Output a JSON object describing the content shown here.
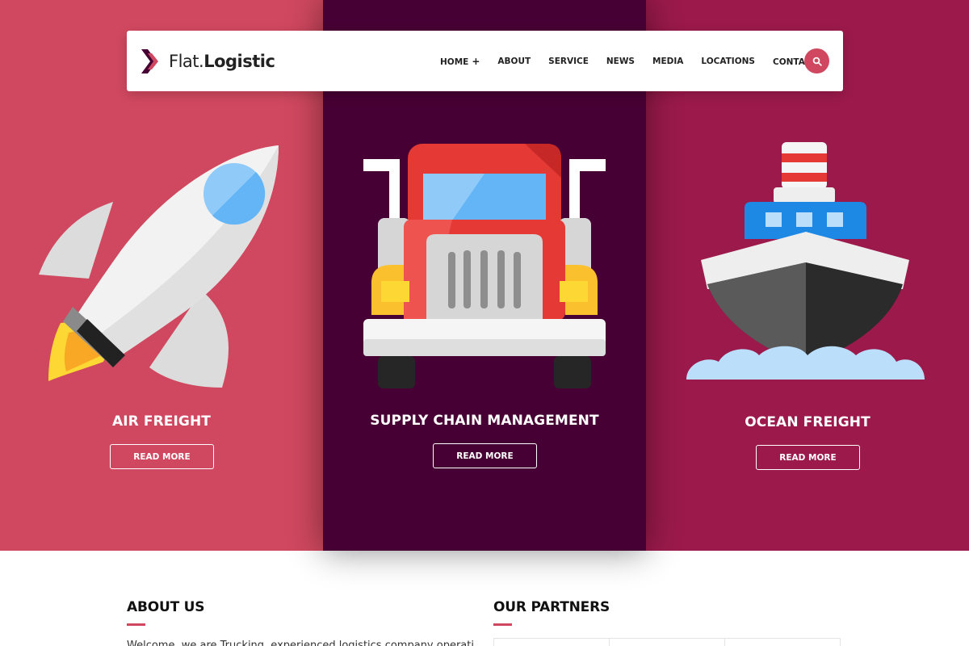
{
  "brand": {
    "name_light": "Flat.",
    "name_bold": "Logistic",
    "accent_color": "#d0485f",
    "dark_color": "#470033",
    "wine_color": "#9b1a4b"
  },
  "nav": {
    "items": [
      {
        "label": "HOME",
        "has_dropdown": true
      },
      {
        "label": "ABOUT",
        "has_dropdown": false
      },
      {
        "label": "SERVICE",
        "has_dropdown": false
      },
      {
        "label": "NEWS",
        "has_dropdown": false
      },
      {
        "label": "MEDIA",
        "has_dropdown": false
      },
      {
        "label": "LOCATIONS",
        "has_dropdown": false
      },
      {
        "label": "CONTACT",
        "has_dropdown": true
      }
    ],
    "dropdown_glyph": "+",
    "search_icon": "search-icon"
  },
  "services": [
    {
      "title": "AIR FREIGHT",
      "button": "READ MORE",
      "icon": "rocket-icon"
    },
    {
      "title": "SUPPLY CHAIN MANAGEMENT",
      "button": "READ MORE",
      "icon": "truck-icon"
    },
    {
      "title": "OCEAN FREIGHT",
      "button": "READ MORE",
      "icon": "ship-icon"
    }
  ],
  "about": {
    "title": "ABOUT US",
    "text": "Welcome, we are Trucking, experienced logistics company operating"
  },
  "partners": {
    "title": "OUR PARTNERS"
  }
}
